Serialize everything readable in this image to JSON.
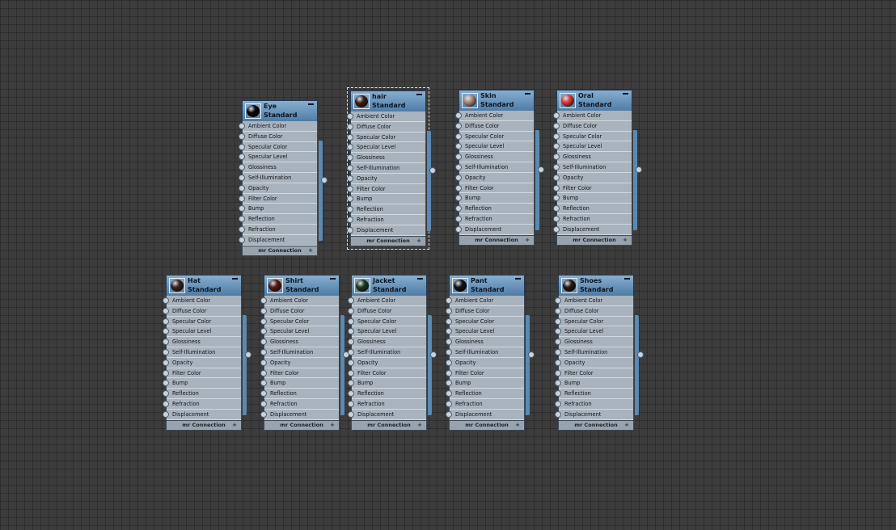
{
  "slot_labels": [
    "Ambient Color",
    "Diffuse Color",
    "Specular Color",
    "Specular Level",
    "Glossiness",
    "Self-Illumination",
    "Opacity",
    "Filter Color",
    "Bump",
    "Reflection",
    "Refraction",
    "Displacement"
  ],
  "footer_label": "mr Connection",
  "footer_icon": "plus-icon",
  "nodes": [
    {
      "name": "Eye",
      "type": "Standard",
      "swatch_color": "#050505",
      "selected": false
    },
    {
      "name": "hair",
      "type": "Standard",
      "swatch_color": "#3a2016",
      "selected": true
    },
    {
      "name": "Skin",
      "type": "Standard",
      "swatch_color": "#b08a78",
      "selected": false
    },
    {
      "name": "Oral",
      "type": "Standard",
      "swatch_color": "#e13a3a",
      "selected": false
    },
    {
      "name": "Hat",
      "type": "Standard",
      "swatch_color": "#3a241c",
      "selected": false
    },
    {
      "name": "Shirt",
      "type": "Standard",
      "swatch_color": "#5c1a16",
      "selected": false
    },
    {
      "name": "Jacket",
      "type": "Standard",
      "swatch_color": "#1f3a20",
      "selected": false
    },
    {
      "name": "Pant",
      "type": "Standard",
      "swatch_color": "#141414",
      "selected": false
    },
    {
      "name": "Shoes",
      "type": "Standard",
      "swatch_color": "#2a1a12",
      "selected": false
    }
  ]
}
